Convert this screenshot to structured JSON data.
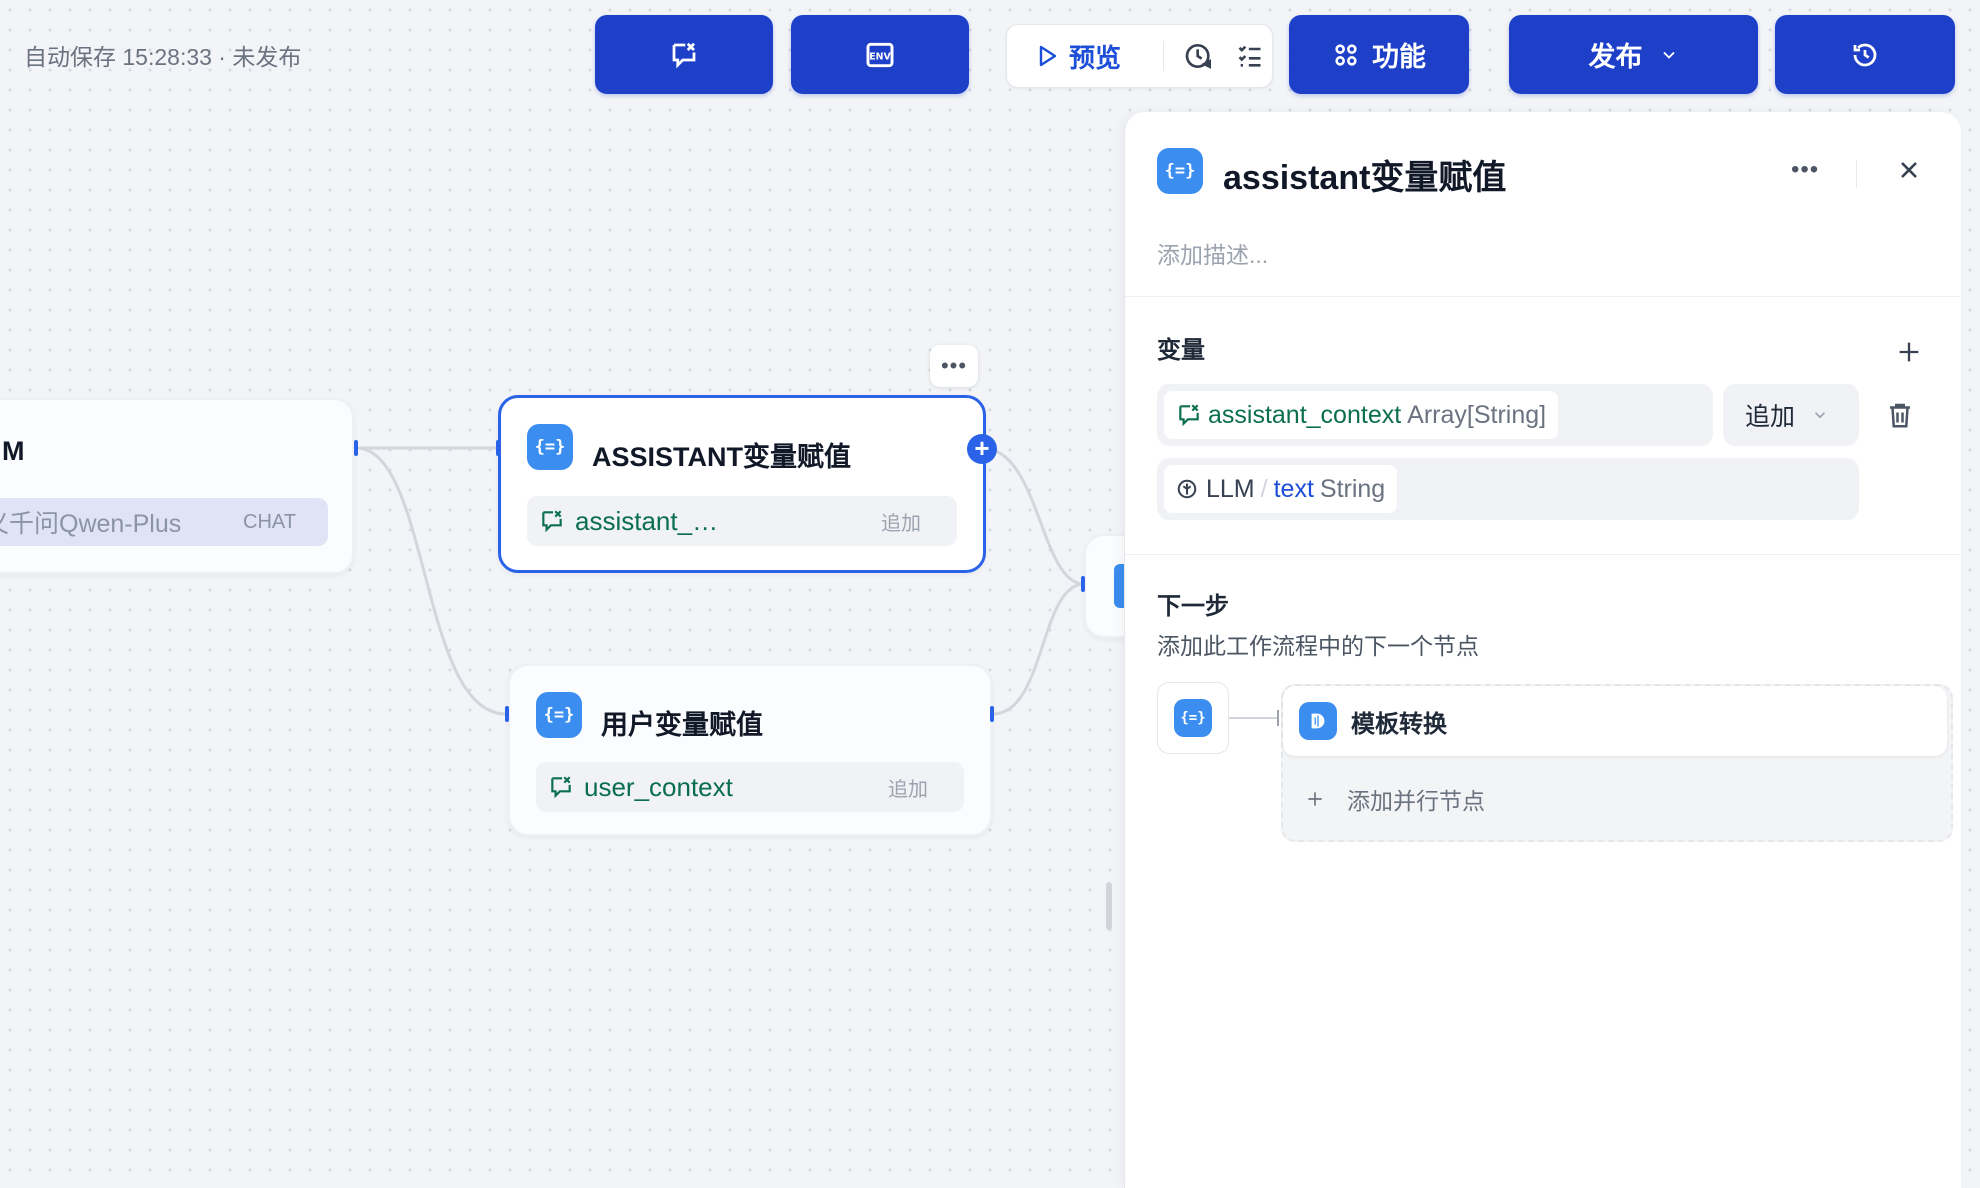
{
  "topbar": {
    "autosave": "自动保存 15:28:33 · 未发布",
    "preview_label": "预览",
    "features_label": "功能",
    "publish_label": "发布"
  },
  "canvas": {
    "llm_node": {
      "title": "M",
      "model_name": "义千问Qwen-Plus",
      "model_mode": "CHAT"
    },
    "assistant_node": {
      "title": "ASSISTANT变量赋值",
      "var_name": "assistant_…",
      "operation": "追加"
    },
    "user_node": {
      "title": "用户变量赋值",
      "var_name": "user_context",
      "operation": "追加"
    }
  },
  "panel": {
    "title": "assistant变量赋值",
    "description_placeholder": "添加描述...",
    "variables_title": "变量",
    "target_var": "assistant_context",
    "target_type": "Array[String]",
    "operation": "追加",
    "source_node": "LLM",
    "source_sep": "/",
    "source_var": "text",
    "source_type": "String",
    "next_title": "下一步",
    "next_subtitle": "添加此工作流程中的下一个节点",
    "next_node": "模板转换",
    "add_parallel": "添加并行节点"
  },
  "colors": {
    "primary": "#1e40c9",
    "accent": "#2a63e8",
    "variable_green": "#0b6e4f",
    "node_icon": "#3b8df0"
  }
}
